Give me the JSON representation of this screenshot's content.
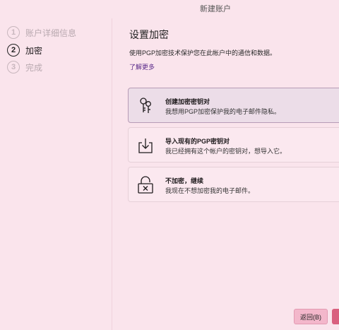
{
  "window": {
    "title": "新建账户"
  },
  "steps": [
    {
      "num": "1",
      "label": "账户详细信息",
      "state": "done"
    },
    {
      "num": "2",
      "label": "加密",
      "state": "active"
    },
    {
      "num": "3",
      "label": "完成",
      "state": "todo"
    }
  ],
  "main": {
    "heading": "设置加密",
    "description": "使用PGP加密技术保护您在此帐户中的通信和数据。",
    "learn_more": "了解更多"
  },
  "options": [
    {
      "title": "创建加密密钥对",
      "subtitle": "我想用PGP加密保护我的电子邮件隐私。",
      "icon": "keys-icon",
      "selected": true
    },
    {
      "title": "导入现有的PGP密钥对",
      "subtitle": "我已经拥有这个帐户的密钥对，想导入它。",
      "icon": "import-icon",
      "selected": false
    },
    {
      "title": "不加密，继续",
      "subtitle": "我现在不想加密我的电子邮件。",
      "icon": "unlocked-icon",
      "selected": false
    }
  ],
  "buttons": {
    "back": "返回(B)"
  }
}
